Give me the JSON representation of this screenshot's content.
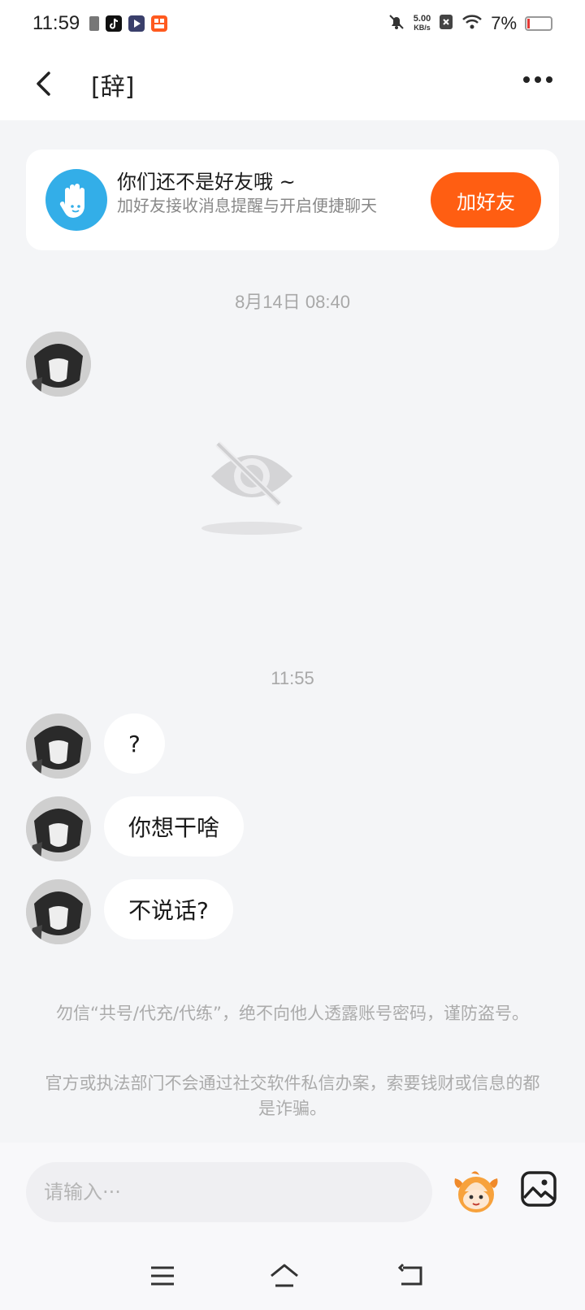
{
  "status_bar": {
    "time": "11:59",
    "net_speed_value": "5.00",
    "net_speed_unit": "KB/s",
    "battery": "7%"
  },
  "header": {
    "title": "[辞]"
  },
  "friend_notice": {
    "title": "你们还不是好友哦 ~",
    "subtitle": "加好友接收消息提醒与开启便捷聊天",
    "button": "加好友"
  },
  "timestamps": [
    "8月14日 08:40",
    "11:55"
  ],
  "messages": [
    {
      "text": "?"
    },
    {
      "text": "你想干啥"
    },
    {
      "text": "不说话?"
    }
  ],
  "warnings": [
    "勿信“共号/代充/代练”，绝不向他人透露账号密码，谨防盗号。",
    "官方或执法部门不会通过社交软件私信办案，索要钱财或信息的都是诈骗。"
  ],
  "input": {
    "placeholder": "请输入···"
  },
  "colors": {
    "accent": "#ff5e12",
    "notice_icon": "#33aee8",
    "background": "#f4f5f7"
  }
}
